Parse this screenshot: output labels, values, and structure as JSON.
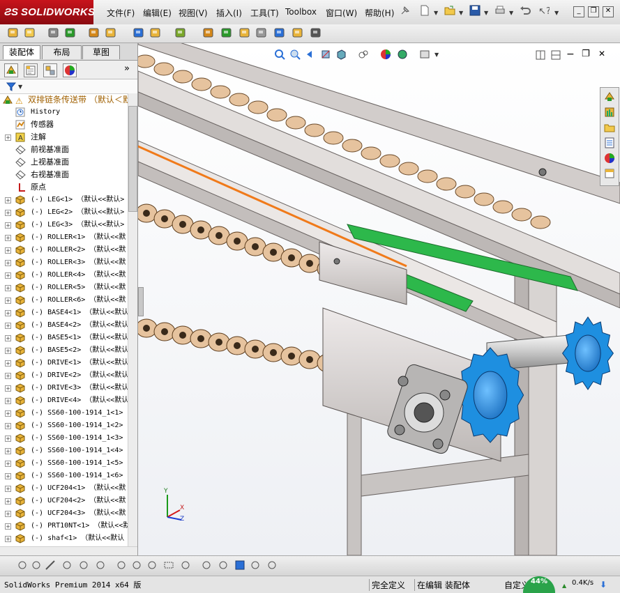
{
  "app": {
    "brand_ds": "3S",
    "brand_name": "SOLIDWORKS"
  },
  "menu": [
    {
      "label": "文件(F)"
    },
    {
      "label": "编辑(E)"
    },
    {
      "label": "视图(V)"
    },
    {
      "label": "插入(I)"
    },
    {
      "label": "工具(T)"
    },
    {
      "label": "Toolbox"
    },
    {
      "label": "窗口(W)"
    },
    {
      "label": "帮助(H)"
    }
  ],
  "panel_tabs": [
    {
      "label": "装配体",
      "active": true
    },
    {
      "label": "布局",
      "active": false
    },
    {
      "label": "草图",
      "active": false
    }
  ],
  "feature_tree": {
    "root_label": "双排链条传送带 （默认＜默",
    "items": [
      {
        "label": "History",
        "icon": "history-icon",
        "expandable": false
      },
      {
        "label": "传感器",
        "icon": "sensor-icon",
        "expandable": false
      },
      {
        "label": "注解",
        "icon": "annotation-icon",
        "expandable": true
      },
      {
        "label": "前视基准面",
        "icon": "plane-icon",
        "expandable": false
      },
      {
        "label": "上视基准面",
        "icon": "plane-icon",
        "expandable": false
      },
      {
        "label": "右视基准面",
        "icon": "plane-icon",
        "expandable": false
      },
      {
        "label": "原点",
        "icon": "origin-icon",
        "expandable": false
      }
    ],
    "components": [
      "(-) LEG<1> （默认<<默认>",
      "(-) LEG<2> （默认<<默认>",
      "(-) LEG<3> （默认<<默认>",
      "(-) ROLLER<1> （默认<<默",
      "(-) ROLLER<2> （默认<<默",
      "(-) ROLLER<3> （默认<<默",
      "(-) ROLLER<4> （默认<<默",
      "(-) ROLLER<5> （默认<<默",
      "(-) ROLLER<6> （默认<<默",
      "(-) BASE4<1> （默认<<默认",
      "(-) BASE4<2> （默认<<默认",
      "(-) BASE5<1> （默认<<默认",
      "(-) BASE5<2> （默认<<默认",
      "(-) DRIVE<1> （默认<<默认",
      "(-) DRIVE<2> （默认<<默认",
      "(-) DRIVE<3> （默认<<默认",
      "(-) DRIVE<4> （默认<<默认",
      "(-) SS60-100-1914_1<1>",
      "(-) SS60-100-1914_1<2>",
      "(-) SS60-100-1914_1<3>",
      "(-) SS60-100-1914_1<4>",
      "(-) SS60-100-1914_1<5>",
      "(-) SS60-100-1914_1<6>",
      "(-) UCF204<1> （默认<<默",
      "(-) UCF204<2> （默认<<默",
      "(-) UCF204<3> （默认<<默",
      "(-) PRT10NT<1> （默认<<默",
      "(-) shaf<1> （默认<<默认"
    ]
  },
  "triad": {
    "x": "X",
    "y": "Y",
    "z": "Z"
  },
  "status": {
    "product": "SolidWorks Premium 2014 x64 版",
    "definition": "完全定义",
    "mode": "在编辑 装配体",
    "units": "自定义",
    "cpu": "44%",
    "net": "0.4K/s"
  },
  "colors": {
    "sprocket_blue": "#1e8fe0",
    "chain_tan": "#e6c39e",
    "guide_green": "#2db84b",
    "frame_grey": "#c8c4c2",
    "brand_red": "#c8141c"
  }
}
